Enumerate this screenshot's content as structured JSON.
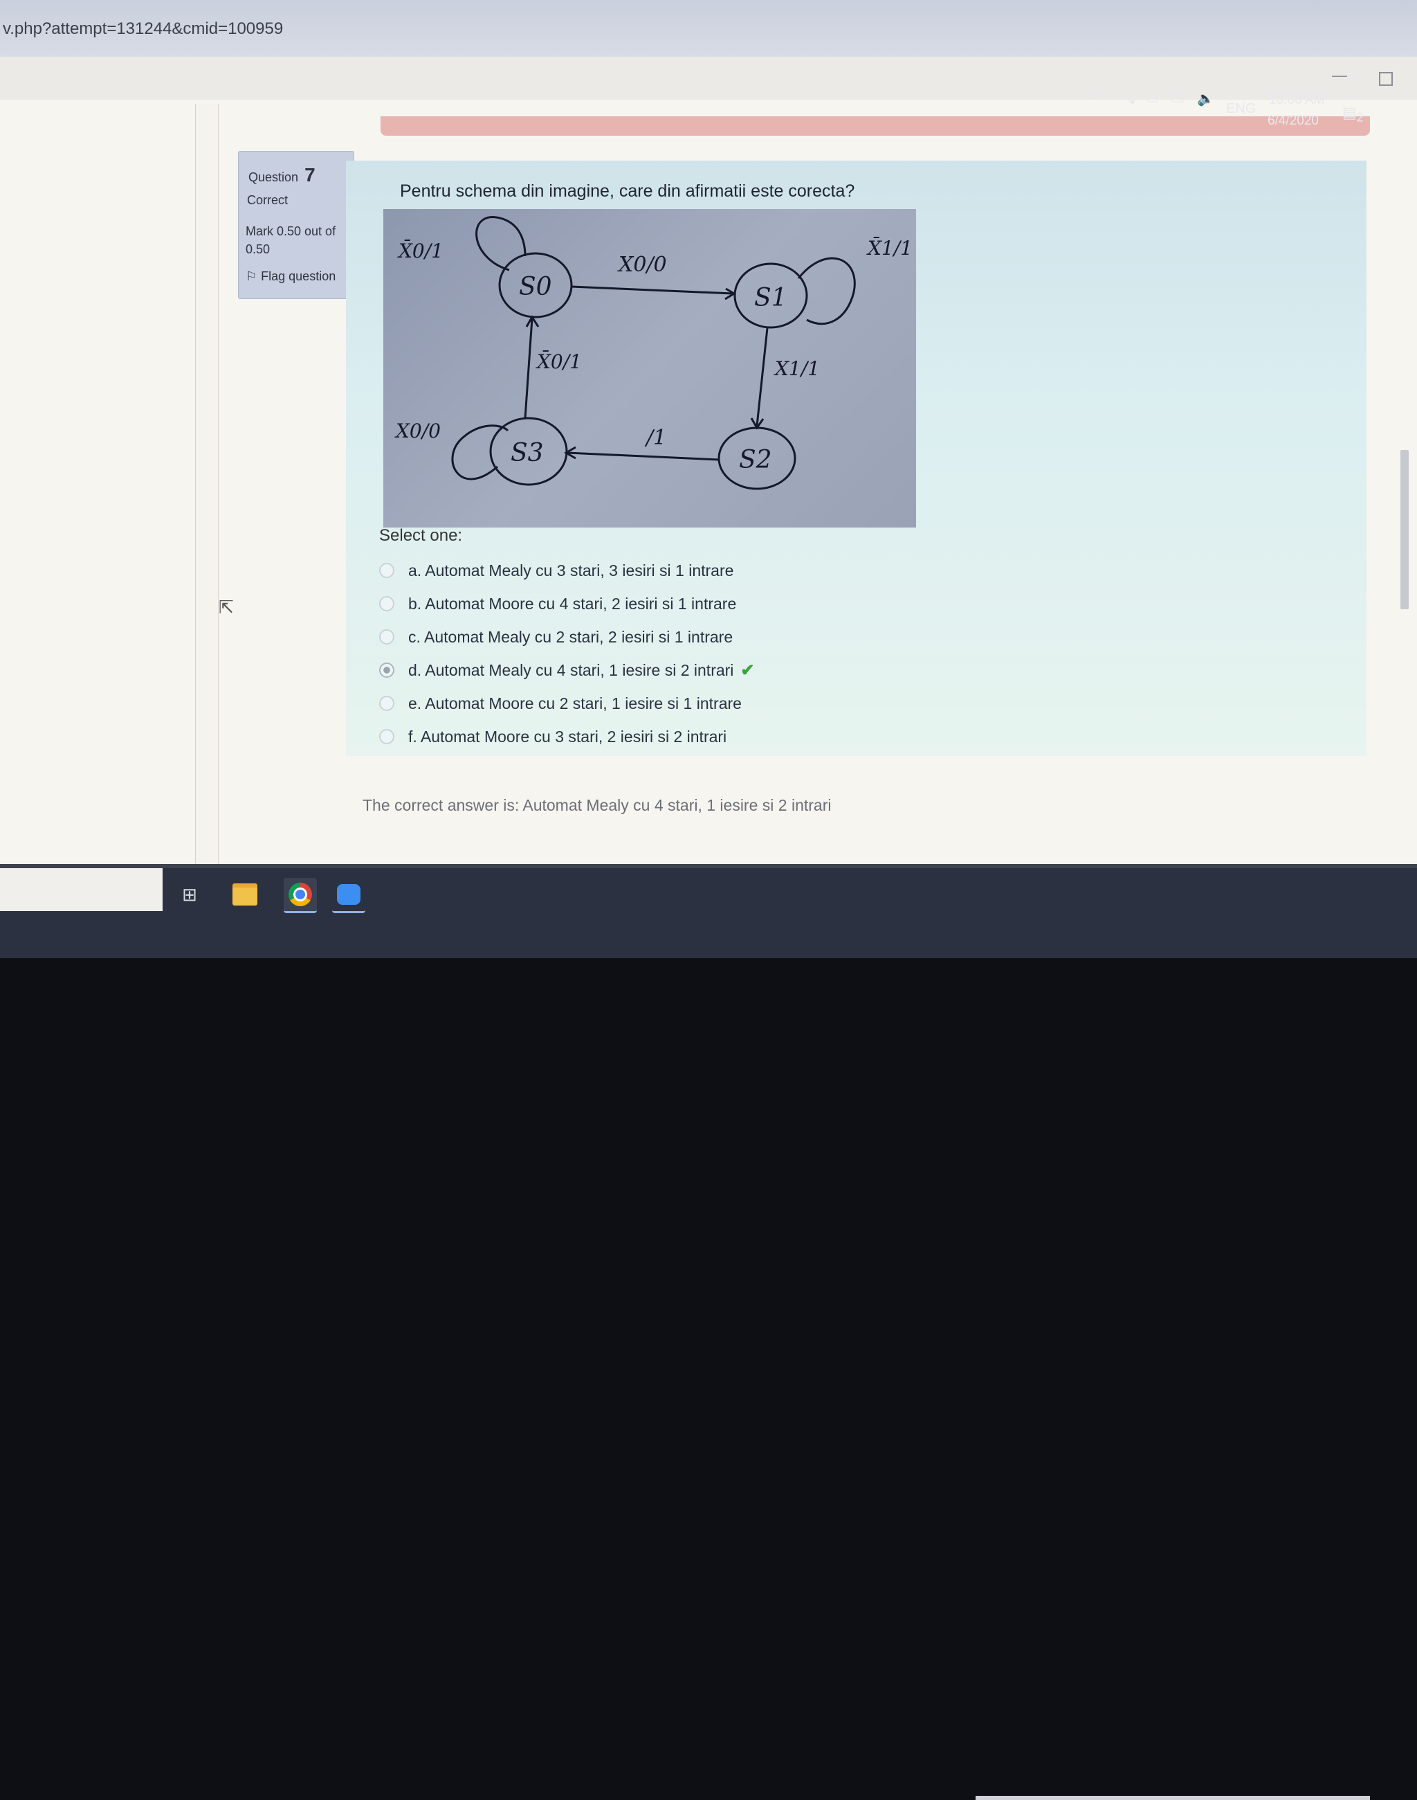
{
  "browser": {
    "url": "v.php?attempt=131244&cmid=100959",
    "window_min": "—"
  },
  "question_info": {
    "question_word": "Question",
    "question_number": "7",
    "state": "Correct",
    "mark": "Mark 0.50 out of 0.50",
    "flag_label": "Flag question"
  },
  "question": {
    "text": "Pentru schema din imagine, care din afirmatii este corecta?",
    "select_label": "Select one:",
    "options": [
      {
        "label": "a. Automat Mealy cu 3 stari, 3 iesiri si 1 intrare",
        "selected": false,
        "correct": false
      },
      {
        "label": "b. Automat Moore cu 4 stari, 2 iesiri si 1 intrare",
        "selected": false,
        "correct": false
      },
      {
        "label": "c. Automat Mealy cu 2 stari, 2 iesiri si 1 intrare",
        "selected": false,
        "correct": false
      },
      {
        "label": "d. Automat Mealy cu 4 stari, 1 iesire si 2 intrari",
        "selected": true,
        "correct": true
      },
      {
        "label": "e. Automat Moore cu 2 stari, 1 iesire si 1 intrare",
        "selected": false,
        "correct": false
      },
      {
        "label": "f. Automat Moore cu 3 stari, 2 iesiri si 2 intrari",
        "selected": false,
        "correct": false
      }
    ],
    "correct_answer": "The correct answer is: Automat Mealy cu 4 stari, 1 iesire si 2 intrari"
  },
  "diagram": {
    "states": [
      "S0",
      "S1",
      "S2",
      "S3"
    ],
    "labels": {
      "s0_self": "X̄0/1",
      "s0_s1": "X0/0",
      "s1_self": "X̄1/1",
      "s1_s2": "X1/1",
      "s2_s3": "/1",
      "s3_s0": "X̄0/1",
      "s3_self": "X0/0"
    }
  },
  "taskbar": {
    "apps": [
      "task-view",
      "file-explorer",
      "chrome",
      "zoom"
    ],
    "language": "ENG",
    "time": "10:00 AM",
    "date": "6/4/2020",
    "notifications": "2"
  },
  "colors": {
    "info_box": "#c7cfe0",
    "content_box": "#dbeef0",
    "correct_check": "#3aa33a",
    "taskbar": "#2b3140"
  }
}
